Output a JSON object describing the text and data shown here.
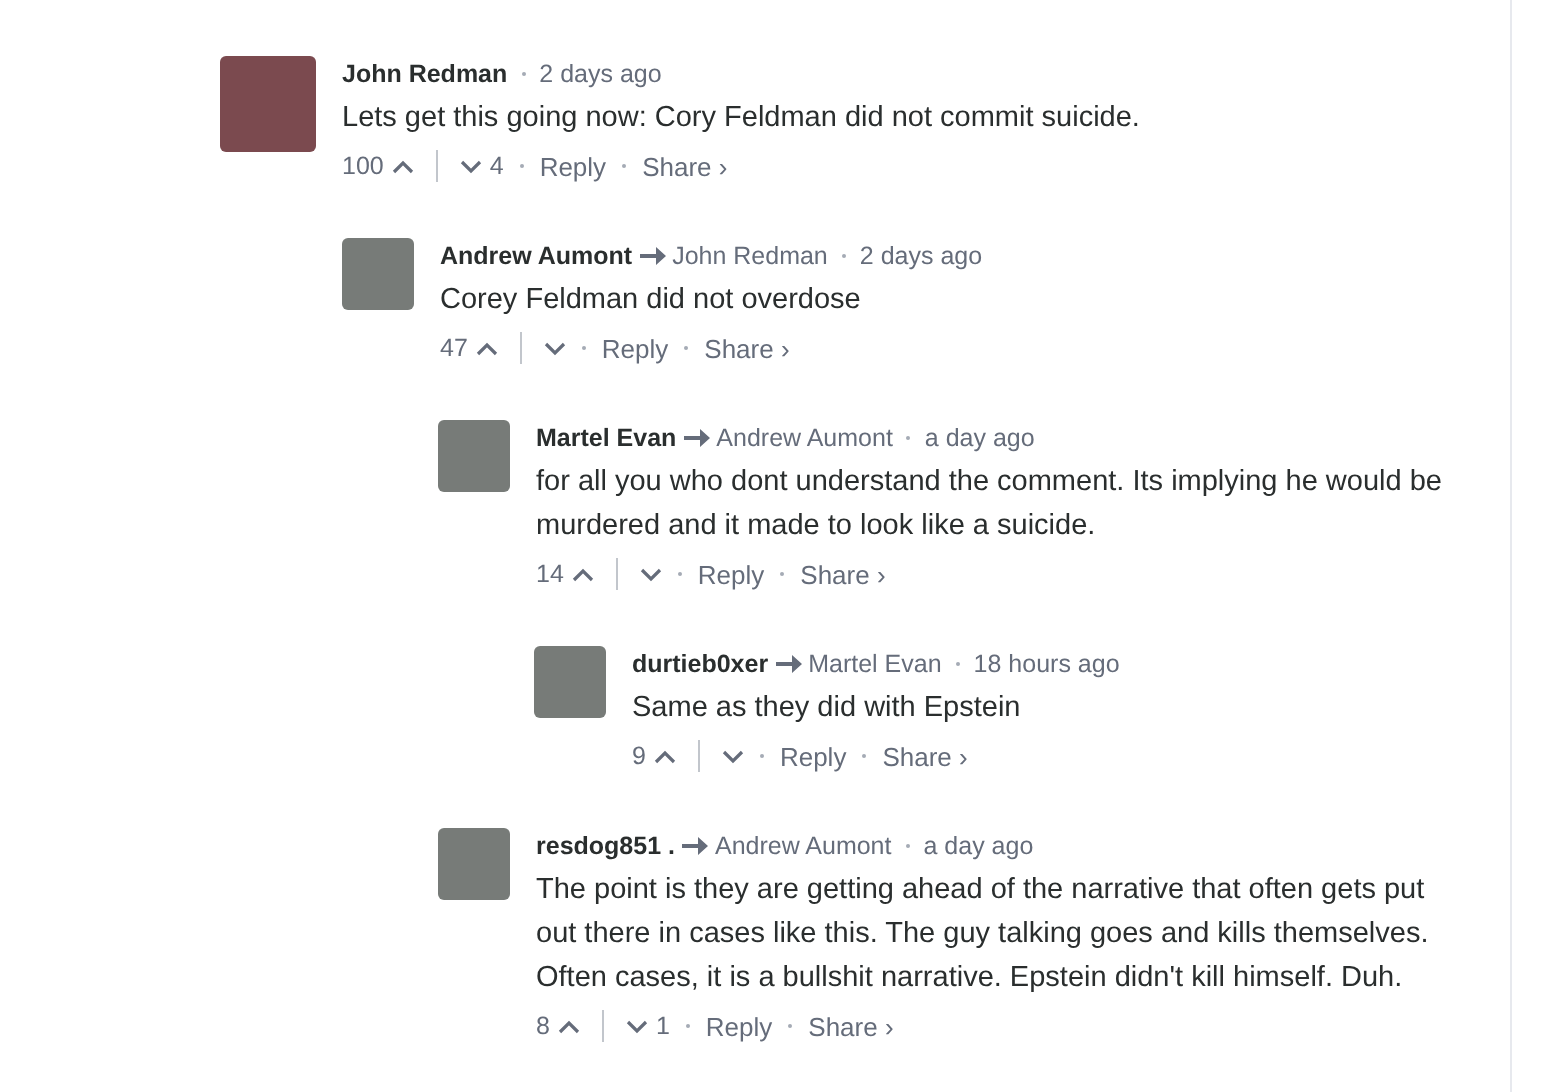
{
  "comments": [
    {
      "author": "John Redman",
      "time": "2 days ago",
      "text": "Lets get this going now: Cory Feldman did not commit suicide.",
      "upvotes": "100",
      "downvotes": "4",
      "reply": "Reply",
      "share": "Share ›",
      "children": [
        {
          "author": "Andrew Aumont",
          "reply_to": "John Redman",
          "time": "2 days ago",
          "text": "Corey Feldman did not overdose",
          "upvotes": "47",
          "reply": "Reply",
          "share": "Share ›",
          "children": [
            {
              "author": "Martel Evan",
              "reply_to": "Andrew Aumont",
              "time": "a day ago",
              "text": "for all you who dont understand the comment. Its implying he would be murdered and it made to look like a suicide.",
              "upvotes": "14",
              "reply": "Reply",
              "share": "Share ›",
              "children": [
                {
                  "author": "durtieb0xer",
                  "reply_to": "Martel Evan",
                  "time": "18 hours ago",
                  "text": "Same as they did with Epstein",
                  "upvotes": "9",
                  "reply": "Reply",
                  "share": "Share ›"
                }
              ]
            },
            {
              "author": "resdog851 .",
              "reply_to": "Andrew Aumont",
              "time": "a day ago",
              "text": "The point is they are getting ahead of the narrative that often gets put out there in cases like this. The guy talking goes and kills themselves. Often cases, it is a bullshit narrative. Epstein didn't kill himself. Duh.",
              "upvotes": "8",
              "downvotes": "1",
              "reply": "Reply",
              "share": "Share ›"
            }
          ]
        }
      ]
    }
  ]
}
